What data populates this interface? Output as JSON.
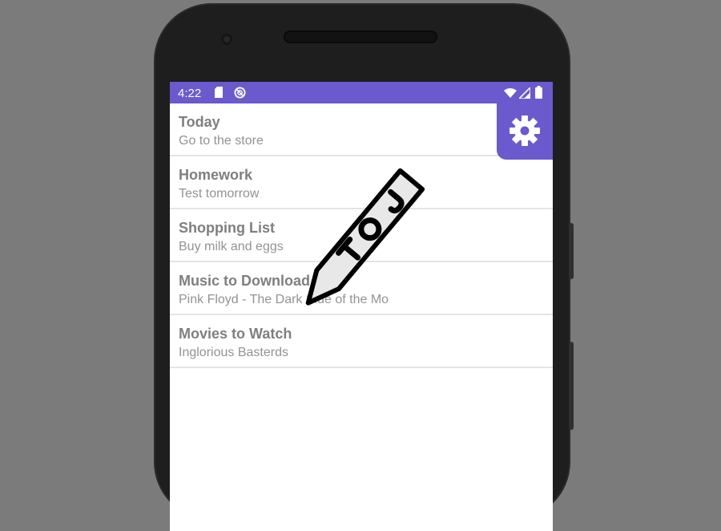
{
  "status_bar": {
    "time": "4:22",
    "background": "#6a5acd",
    "icons": [
      "sd-card-icon",
      "sync-icon",
      "wifi-icon",
      "signal-icon",
      "battery-icon"
    ]
  },
  "notes": [
    {
      "title": "Today",
      "subtitle": "Go to the store"
    },
    {
      "title": "Homework",
      "subtitle": "Test tomorrow"
    },
    {
      "title": "Shopping List",
      "subtitle": "Buy milk and eggs"
    },
    {
      "title": "Music to Download",
      "subtitle": "Pink Floyd - The Dark Side of the Mo"
    },
    {
      "title": "Movies to Watch",
      "subtitle": "Inglorious Basterds"
    }
  ],
  "settings_button": {
    "icon": "gear-icon",
    "color": "#6a5acd"
  },
  "logo": {
    "icon": "pencil-icon",
    "lettering": "JOT"
  }
}
